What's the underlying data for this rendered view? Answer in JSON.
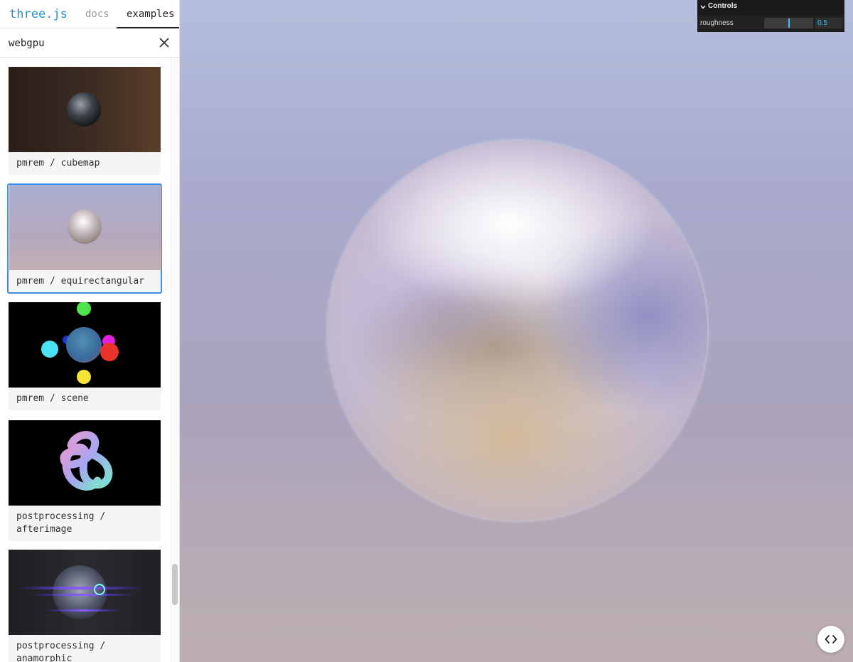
{
  "app": {
    "title": "three.js"
  },
  "header": {
    "tabs": [
      {
        "label": "docs",
        "active": false
      },
      {
        "label": "examples",
        "active": true
      }
    ]
  },
  "filter": {
    "value": "webgpu",
    "clear_icon": "close-icon"
  },
  "examples": [
    {
      "label": "pmrem / cubemap",
      "selected": false
    },
    {
      "label": "pmrem / equirectangular",
      "selected": true
    },
    {
      "label": "pmrem / scene",
      "selected": false
    },
    {
      "label": "postprocessing /\nafterimage",
      "selected": false
    },
    {
      "label": "postprocessing /\nanamorphic",
      "selected": false
    }
  ],
  "controls": {
    "title": "Controls",
    "parameters": [
      {
        "label": "roughness",
        "value": "0.5",
        "fraction": 0.5
      }
    ]
  },
  "source_button": {
    "icon": "code-icon"
  },
  "colors": {
    "brand": "#2194ce",
    "selection": "#3d8fe6",
    "controls_accent": "#2cc9ff"
  }
}
